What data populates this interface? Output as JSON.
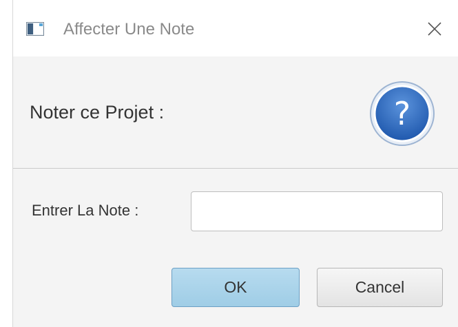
{
  "window": {
    "title": "Affecter Une Note"
  },
  "header": {
    "text": "Noter ce Projet :"
  },
  "icons": {
    "app": "window-app-icon",
    "close": "close-icon",
    "help": "question-mark-icon"
  },
  "form": {
    "label": "Entrer La Note :",
    "value": "",
    "placeholder": ""
  },
  "buttons": {
    "ok": "OK",
    "cancel": "Cancel"
  },
  "colors": {
    "help_circle": "#2e6bbf",
    "ok_button": "#a9d3ea",
    "cancel_button": "#ececec"
  }
}
